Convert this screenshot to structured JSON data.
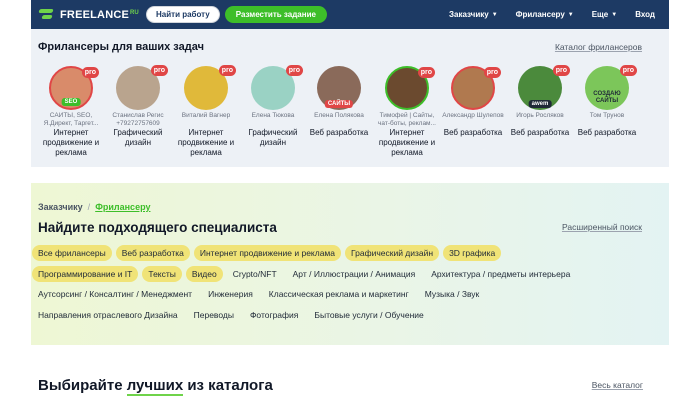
{
  "header": {
    "logo_text": "FREELANCE",
    "logo_suffix": "RU",
    "find_work_label": "Найти работу",
    "post_task_label": "Разместить задание",
    "nav": [
      {
        "label": "Заказчику"
      },
      {
        "label": "Фрилансеру"
      },
      {
        "label": "Еще"
      },
      {
        "label": "Вход"
      }
    ]
  },
  "freelancers": {
    "title": "Фрилансеры для ваших задач",
    "catalog_link": "Каталог фрилансеров",
    "items": [
      {
        "name": "САЙТЫ, SEO, Я.Директ, Таргет...",
        "spec": "Интернет продвижение и реклама",
        "pro": "pro",
        "badge": "SEO",
        "avatar_color": "#d98b6a"
      },
      {
        "name": "Станислав Регис +79272757609",
        "spec": "Графический дизайн",
        "pro": "pro",
        "badge": "",
        "avatar_color": "#b9a48e"
      },
      {
        "name": "Виталий Вагнер",
        "spec": "Интернет продвижение и реклама",
        "pro": "pro",
        "badge": "",
        "avatar_color": "#e0b93a"
      },
      {
        "name": "Елена Тюкова",
        "spec": "Графический дизайн",
        "pro": "pro",
        "badge": "",
        "avatar_color": "#9ad2c4"
      },
      {
        "name": "Елена Полякова",
        "spec": "Веб разработка",
        "pro": "",
        "badge": "САЙТЫ",
        "avatar_color": "#8a6a5a"
      },
      {
        "name": "Тимофей | Сайты, чат-боты, реклам...",
        "spec": "Интернет продвижение и реклама",
        "pro": "pro",
        "badge": "",
        "avatar_color": "#6b4a2f"
      },
      {
        "name": "Александр Шулепов",
        "spec": "Веб разработка",
        "pro": "pro",
        "badge": "",
        "avatar_color": "#b0794f"
      },
      {
        "name": "Игорь Росляков",
        "spec": "Веб разработка",
        "pro": "pro",
        "badge": "awem",
        "avatar_color": "#4b8a3c"
      },
      {
        "name": "Том Трунов",
        "spec": "Веб разработка",
        "pro": "pro",
        "badge": "СОЗДАЮ САЙТЫ",
        "avatar_color": "#7cc65a"
      }
    ]
  },
  "find": {
    "breadcrumb_customer": "Заказчику",
    "breadcrumb_separator": "/",
    "breadcrumb_freelancer": "Фрилансеру",
    "title": "Найдите подходящего специалиста",
    "advanced_search": "Расширенный поиск",
    "rows": [
      [
        {
          "label": "Все фрилансеры",
          "highlight": true
        },
        {
          "label": "Веб разработка",
          "highlight": true
        },
        {
          "label": "Интернет продвижение и реклама",
          "highlight": true
        },
        {
          "label": "Графический дизайн",
          "highlight": true
        },
        {
          "label": "3D графика",
          "highlight": true
        }
      ],
      [
        {
          "label": "Программирование и IT",
          "highlight": true
        },
        {
          "label": "Тексты",
          "highlight": true
        },
        {
          "label": "Видео",
          "highlight": true
        },
        {
          "label": "Crypto/NFT",
          "highlight": false
        },
        {
          "label": "Арт / Иллюстрации / Анимация",
          "highlight": false
        },
        {
          "label": "Архитектура / предметы интерьера",
          "highlight": false
        }
      ],
      [
        {
          "label": "Аутсорсинг / Консалтинг / Менеджмент",
          "highlight": false
        },
        {
          "label": "Инженерия",
          "highlight": false
        },
        {
          "label": "Классическая реклама и маркетинг",
          "highlight": false
        },
        {
          "label": "Музыка / Звук",
          "highlight": false
        }
      ],
      [
        {
          "label": "Направления отраслевого Дизайна",
          "highlight": false
        },
        {
          "label": "Переводы",
          "highlight": false
        },
        {
          "label": "Фотография",
          "highlight": false
        },
        {
          "label": "Бытовые услуги / Обучение",
          "highlight": false
        }
      ]
    ]
  },
  "catalog": {
    "title_start": "Выбирайте ",
    "title_highlight": "лучших",
    "title_end": " из каталога",
    "all_link": "Весь каталог"
  },
  "colors": {
    "header_bg": "#1d3a64",
    "accent_green": "#3dbe29",
    "pro_red": "#e04646",
    "chip_yellow": "#f0e377"
  }
}
